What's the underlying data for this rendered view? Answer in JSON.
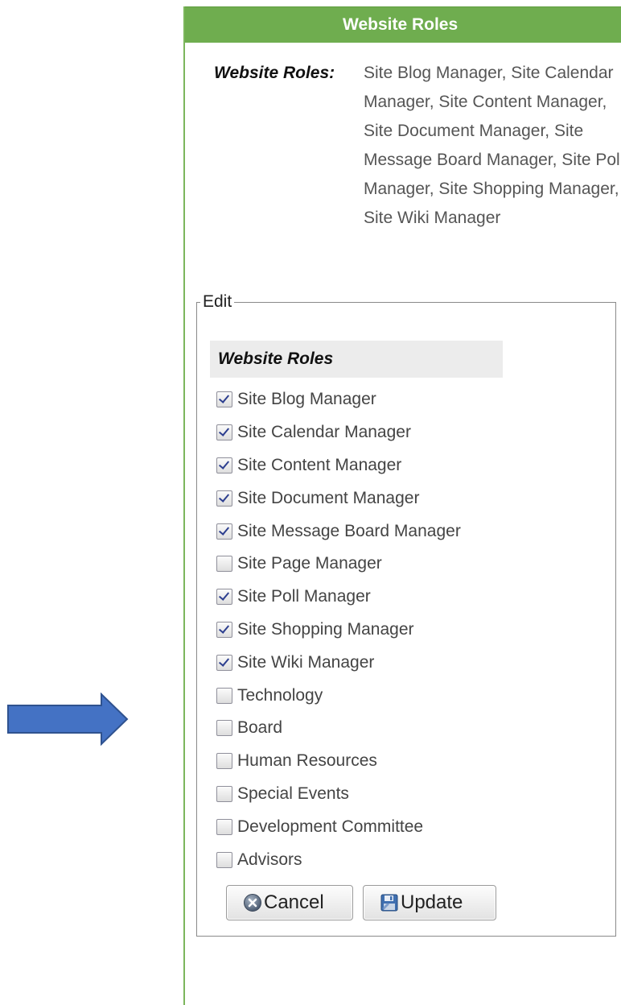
{
  "panel": {
    "title": "Website Roles",
    "accent_color": "#6fad4f"
  },
  "summary": {
    "label": "Website Roles:",
    "value": "Site Blog Manager, Site Calendar Manager, Site Content Manager, Site Document Manager, Site Message Board Manager, Site Poll Manager, Site Shopping Manager, Site Wiki Manager"
  },
  "edit": {
    "legend": "Edit",
    "heading": "Website Roles",
    "roles": [
      {
        "label": "Site Blog Manager",
        "checked": true
      },
      {
        "label": "Site Calendar Manager",
        "checked": true
      },
      {
        "label": "Site Content Manager",
        "checked": true
      },
      {
        "label": "Site Document Manager",
        "checked": true
      },
      {
        "label": "Site Message Board Manager",
        "checked": true
      },
      {
        "label": "Site Page Manager",
        "checked": false
      },
      {
        "label": "Site Poll Manager",
        "checked": true
      },
      {
        "label": "Site Shopping Manager",
        "checked": true
      },
      {
        "label": "Site Wiki Manager",
        "checked": true
      },
      {
        "label": "Technology",
        "checked": false
      },
      {
        "label": "Board",
        "checked": false
      },
      {
        "label": "Human Resources",
        "checked": false
      },
      {
        "label": "Special Events",
        "checked": false
      },
      {
        "label": "Development Committee",
        "checked": false
      },
      {
        "label": "Advisors",
        "checked": false
      }
    ],
    "cancel_label": "Cancel",
    "update_label": "Update",
    "cancel_icon": "cancel-x-circle-icon",
    "update_icon": "floppy-disk-save-icon"
  },
  "annotation": {
    "arrow_icon": "right-arrow-icon",
    "arrow_color": "#4472c4"
  }
}
